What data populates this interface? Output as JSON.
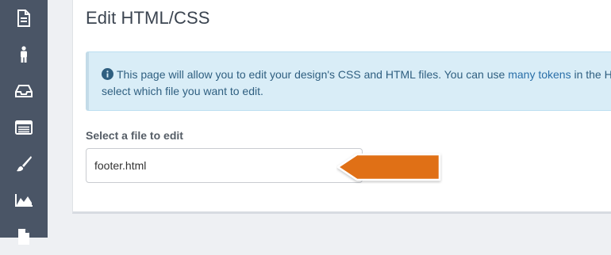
{
  "sidebar": {
    "items": [
      {
        "icon": "document-icon"
      },
      {
        "icon": "person-icon"
      },
      {
        "icon": "inbox-icon"
      },
      {
        "icon": "list-icon"
      },
      {
        "icon": "paintbrush-icon"
      },
      {
        "icon": "chart-icon"
      },
      {
        "icon": "file-icon"
      }
    ]
  },
  "page": {
    "title": "Edit HTML/CSS"
  },
  "alert": {
    "text_before": "This page will allow you to edit your design's CSS and HTML files. You can use ",
    "link": "many tokens",
    "text_after": " in the HT",
    "line2": "select which file you want to edit."
  },
  "file_select": {
    "label": "Select a file to edit",
    "value": "footer.html"
  },
  "colors": {
    "sidebar": "#4a5566",
    "alert_bg": "#d9edf7",
    "arrow": "#e07014"
  }
}
